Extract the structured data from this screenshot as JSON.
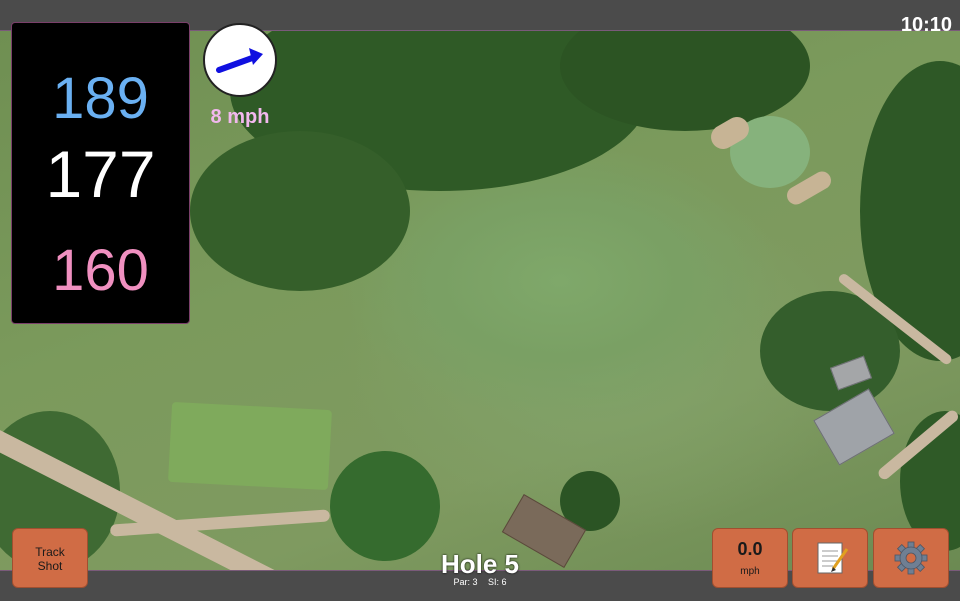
{
  "status_bar": {
    "time": "10:10"
  },
  "yardages": {
    "back": "189",
    "middle": "177",
    "front": "160"
  },
  "wind": {
    "speed": "8 mph",
    "direction_icon": "wind-arrow-icon"
  },
  "hole": {
    "title": "Hole 5",
    "par": "Par: 3",
    "stroke_index": "SI: 6"
  },
  "buttons": {
    "track_shot_line1": "Track",
    "track_shot_line2": "Shot",
    "speed_value": "0.0",
    "speed_unit": "mph",
    "notes_icon": "notes-icon",
    "settings_icon": "gear-icon"
  },
  "colors": {
    "back_yardage": "#6ab0f2",
    "middle_yardage": "#ffffff",
    "front_yardage": "#f090c0",
    "button_fill": "#d06c45",
    "wind_text": "#f2b8ee"
  }
}
